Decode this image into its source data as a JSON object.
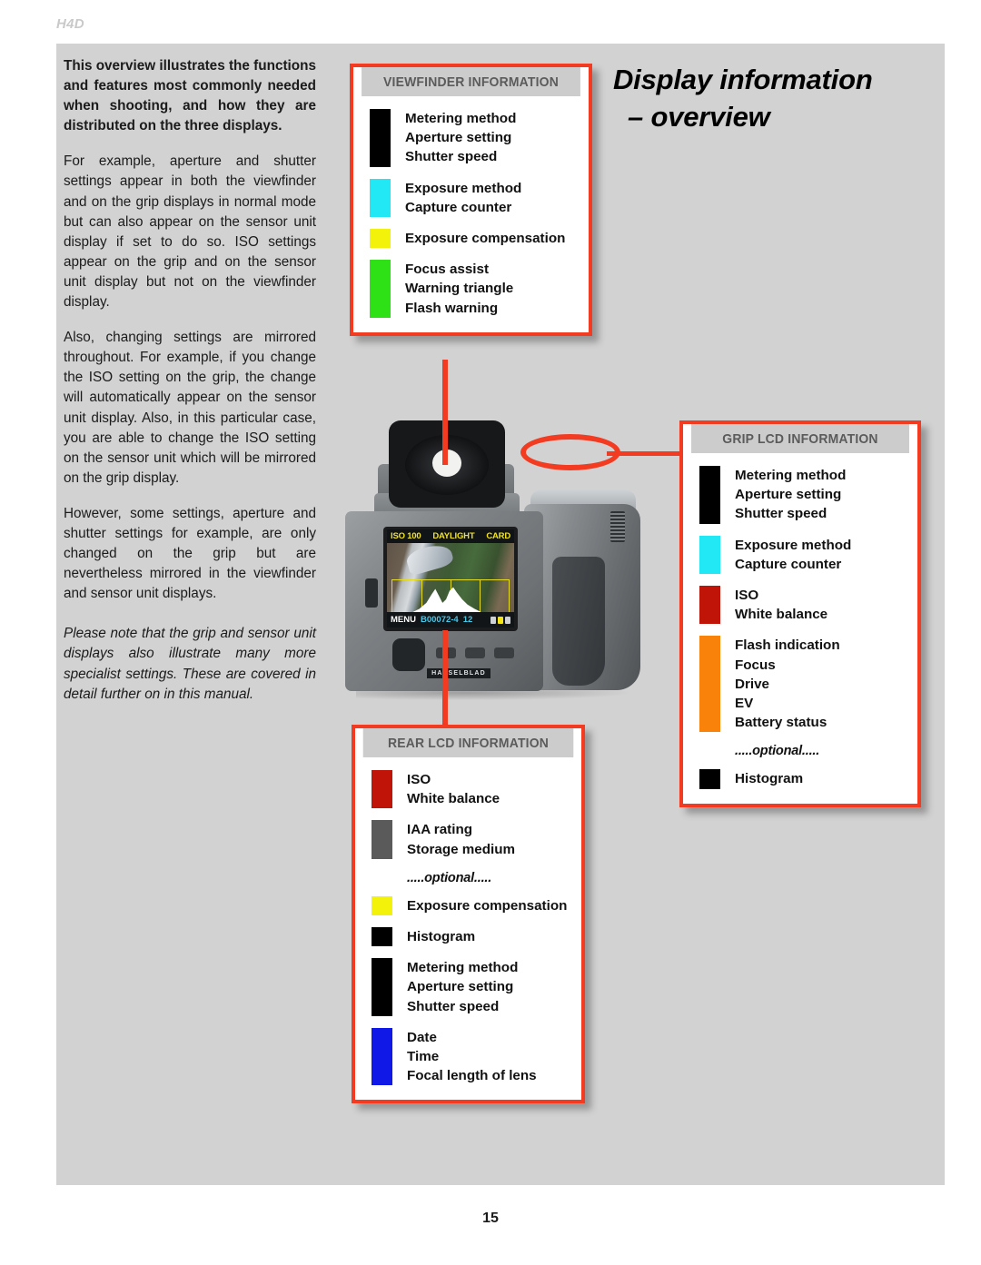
{
  "running_head": "H4D",
  "page_number": "15",
  "title": {
    "line1": "Display information",
    "line2": "– overview"
  },
  "colors": {
    "accent_red": "#f23b20",
    "panel_gray": "#d2d2d2",
    "header_gray": "#cccccc",
    "header_text": "#5b5b5b"
  },
  "body": {
    "paragraphs": [
      "This overview illustrates the functions and features most commonly needed when shooting, and how they are distributed on the three displays.",
      "For example, aperture and shutter settings appear in both the viewfinder and on the grip displays in normal mode but can also appear on the sensor unit display if set to do so. ISO settings appear on the grip and on the sensor unit display but not on the viewfinder display.",
      "Also, changing settings are mirrored throughout. For example, if you change the ISO setting on the grip, the change will automatically appear on the sensor unit display. Also, in this particular case, you are able to change the ISO setting on the sensor unit which will be mirrored on the grip display.",
      "However, some settings, aperture and shutter settings for example, are only changed on the grip but are nevertheless mirrored in the viewfinder and sensor unit displays."
    ],
    "note": "Please note that the grip and sensor unit displays also illustrate many more specialist settings. These are covered in detail further on in this manual."
  },
  "boxes": {
    "viewfinder": {
      "header": "VIEWFINDER INFORMATION",
      "rows": [
        {
          "color": "#000000",
          "labels": [
            "Metering method",
            "Aperture setting",
            "Shutter speed"
          ]
        },
        {
          "color": "#22e8f5",
          "labels": [
            "Exposure method",
            "Capture counter"
          ]
        },
        {
          "color": "#f2f20a",
          "labels": [
            "Exposure compensation"
          ]
        },
        {
          "color": "#2ee016",
          "labels": [
            "Focus assist",
            "Warning triangle",
            "Flash warning"
          ]
        }
      ]
    },
    "grip": {
      "header": "GRIP LCD INFORMATION",
      "rows": [
        {
          "color": "#000000",
          "labels": [
            "Metering method",
            "Aperture setting",
            "Shutter speed"
          ]
        },
        {
          "color": "#22e8f5",
          "labels": [
            "Exposure method",
            "Capture counter"
          ]
        },
        {
          "color": "#c01408",
          "labels": [
            "ISO",
            "White balance"
          ]
        },
        {
          "color": "#f9820a",
          "labels": [
            "Flash indication",
            "Focus",
            "Drive",
            "EV",
            "Battery status"
          ]
        }
      ],
      "optional_label": ".....optional.....",
      "optional_rows": [
        {
          "color": "#000000",
          "labels": [
            "Histogram"
          ]
        }
      ]
    },
    "rear": {
      "header": "REAR LCD INFORMATION",
      "rows": [
        {
          "color": "#c01408",
          "labels": [
            "ISO",
            "White balance"
          ]
        },
        {
          "color": "#5a5a5a",
          "labels": [
            "IAA rating",
            "Storage medium"
          ]
        }
      ],
      "optional_label": ".....optional.....",
      "optional_rows": [
        {
          "color": "#f2f20a",
          "labels": [
            "Exposure compensation"
          ]
        },
        {
          "color": "#000000",
          "labels": [
            "Histogram"
          ]
        },
        {
          "color": "#000000",
          "labels": [
            "Metering method",
            "Aperture setting",
            "Shutter speed"
          ]
        },
        {
          "color": "#1018e8",
          "labels": [
            "Date",
            "Time",
            "Focal length of lens"
          ]
        }
      ]
    }
  },
  "camera": {
    "brand": "HASSELBLAD",
    "lcd": {
      "iso": "ISO 100",
      "white_balance": "DAYLIGHT",
      "media": "CARD",
      "menu": "MENU",
      "file": "B00072-4",
      "count": "12"
    }
  }
}
